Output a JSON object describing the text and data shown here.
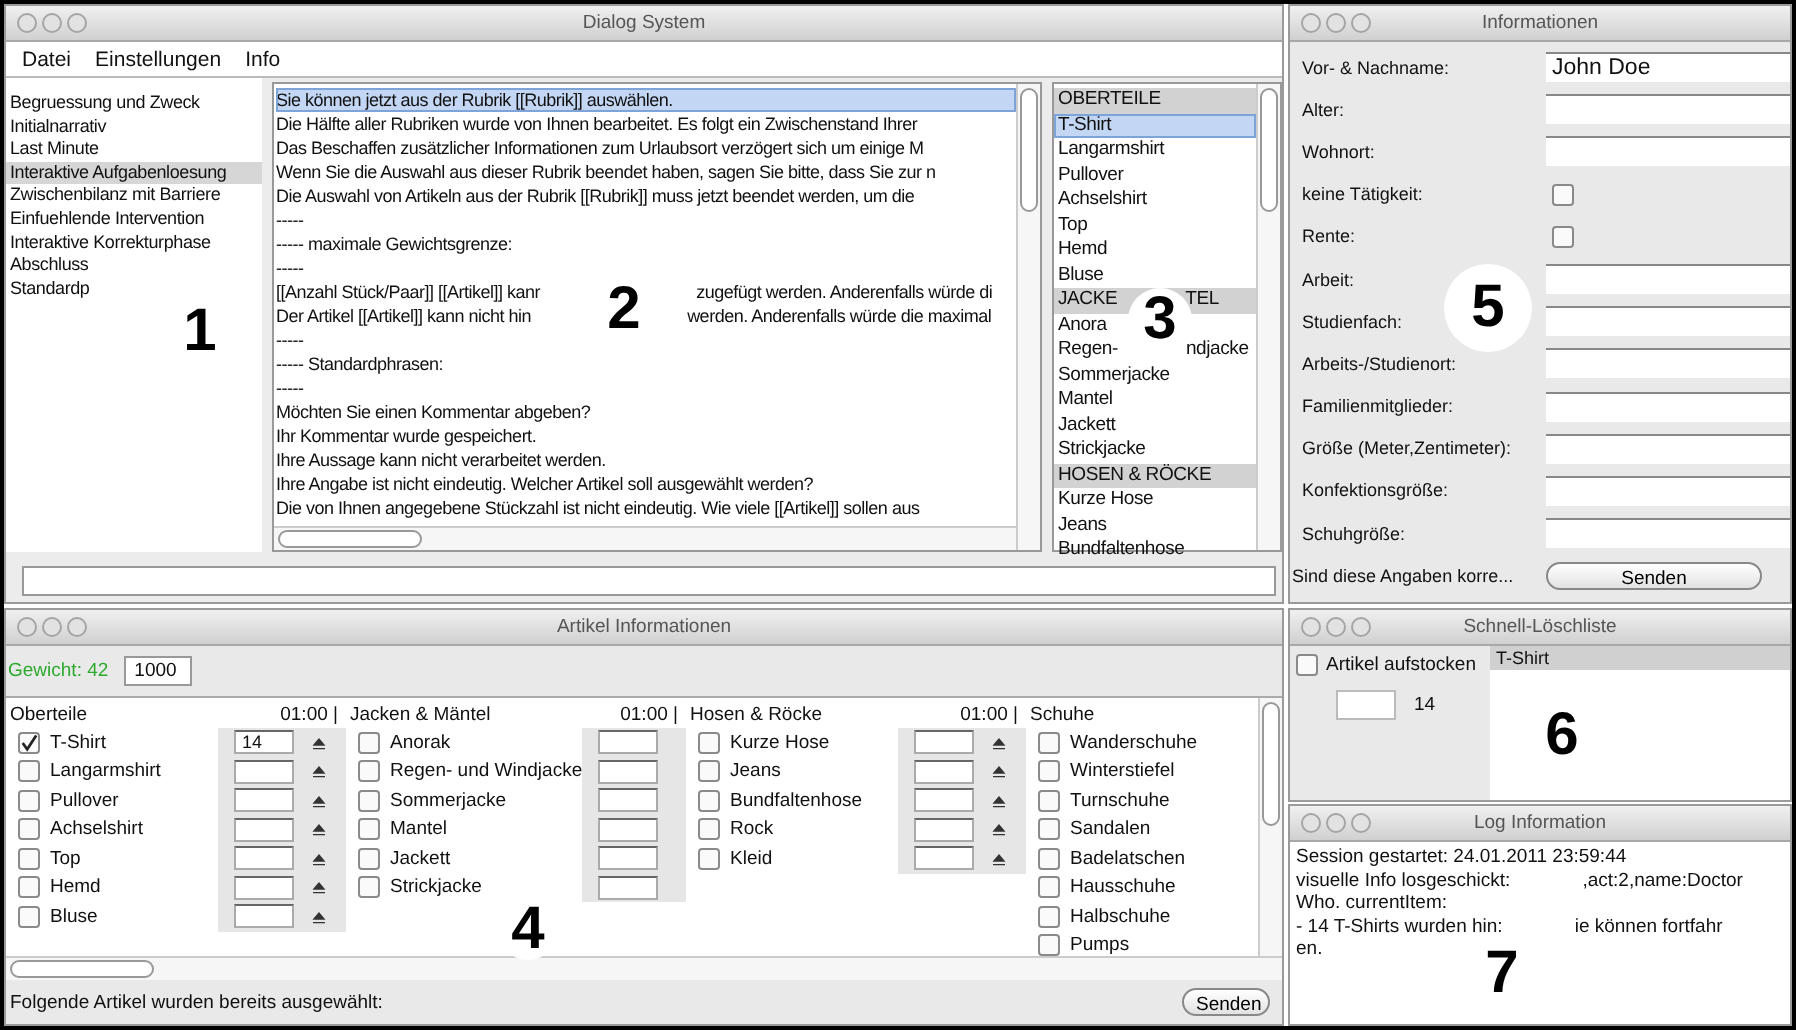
{
  "dialog": {
    "title": "Dialog System",
    "menu": [
      "Datei",
      "Einstellungen",
      "Info"
    ],
    "phases": [
      {
        "parts": [
          "Begruessung und Zweck"
        ],
        "selected": false
      },
      {
        "parts": [
          "Initialnarrativ"
        ],
        "selected": false
      },
      {
        "parts": [
          "Last Minute"
        ],
        "selected": false
      },
      {
        "parts": [
          "Interaktive Aufgabenloesung"
        ],
        "selected": true
      },
      {
        "parts": [
          "Zwischenbilanz mit Barriere"
        ],
        "selected": false
      },
      {
        "parts": [
          "Einfuehlende Intervention"
        ],
        "selected": false
      },
      {
        "parts": [
          "Interaktive Korrekturphase"
        ],
        "selected": false
      },
      {
        "parts": [
          "Abschluss"
        ],
        "selected": false
      },
      {
        "parts": [
          "Standardp"
        ],
        "selected": false
      }
    ],
    "phrases": [
      {
        "parts": [
          "Sie können jetzt aus der Rubrik [[Rubrik]] auswählen."
        ],
        "selected": true
      },
      {
        "parts": [
          "Die Hälfte aller Rubriken wurde von Ihnen bearbeitet. Es folgt ein Zwischenstand Ihrer"
        ],
        "selected": false
      },
      {
        "parts": [
          "Das Beschaffen zusätzlicher Informationen zum Urlaubsort verzögert sich um einige M"
        ],
        "selected": false
      },
      {
        "parts": [
          "Wenn Sie die Auswahl aus dieser Rubrik beendet haben, sagen Sie bitte, dass Sie zur n"
        ],
        "selected": false
      },
      {
        "parts": [
          "Die Auswahl von Artikeln aus der Rubrik [[Rubrik]] muss jetzt beendet werden, um die"
        ],
        "selected": false
      },
      {
        "parts": [
          "-----"
        ],
        "selected": false
      },
      {
        "parts": [
          "----- maximale Gewichtsgrenze:"
        ],
        "selected": false
      },
      {
        "parts": [
          "-----"
        ],
        "selected": false
      },
      {
        "parts": [
          "[[Anzahl Stück/Paar]] [[Artikel]] kanr",
          "zugefügt werden. Anderenfalls würde di"
        ],
        "selected": false
      },
      {
        "parts": [
          "Der Artikel [[Artikel]] kann nicht hin",
          "werden. Anderenfalls würde die maximal"
        ],
        "selected": false
      },
      {
        "parts": [
          "-----"
        ],
        "selected": false
      },
      {
        "parts": [
          "----- Standardphrasen:"
        ],
        "selected": false
      },
      {
        "parts": [
          "-----"
        ],
        "selected": false
      },
      {
        "parts": [
          "Möchten Sie einen Kommentar abgeben?"
        ],
        "selected": false
      },
      {
        "parts": [
          "Ihr Kommentar wurde gespeichert."
        ],
        "selected": false
      },
      {
        "parts": [
          "Ihre Aussage kann nicht verarbeitet werden."
        ],
        "selected": false
      },
      {
        "parts": [
          "Ihre Angabe ist nicht eindeutig. Welcher Artikel soll ausgewählt werden?"
        ],
        "selected": false
      },
      {
        "parts": [
          "Die von Ihnen angegebene Stückzahl ist nicht eindeutig. Wie viele [[Artikel]] sollen aus"
        ],
        "selected": false
      }
    ],
    "articles": [
      {
        "kind": "header",
        "parts": [
          "OBERTEILE"
        ],
        "selected": false
      },
      {
        "kind": "item",
        "parts": [
          "T-Shirt"
        ],
        "selected": true
      },
      {
        "kind": "item",
        "parts": [
          "Langarmshirt"
        ],
        "selected": false
      },
      {
        "kind": "item",
        "parts": [
          "Pullover"
        ],
        "selected": false
      },
      {
        "kind": "item",
        "parts": [
          "Achselshirt"
        ],
        "selected": false
      },
      {
        "kind": "item",
        "parts": [
          "Top"
        ],
        "selected": false
      },
      {
        "kind": "item",
        "parts": [
          "Hemd"
        ],
        "selected": false
      },
      {
        "kind": "item",
        "parts": [
          "Bluse"
        ],
        "selected": false
      },
      {
        "kind": "header",
        "parts": [
          "JACKE",
          "TEL"
        ],
        "selected": false
      },
      {
        "kind": "item",
        "parts": [
          "Anora"
        ],
        "selected": false
      },
      {
        "kind": "item",
        "parts": [
          "Regen-",
          "ndjacke"
        ],
        "selected": false
      },
      {
        "kind": "item",
        "parts": [
          "Sommerjacke"
        ],
        "selected": false
      },
      {
        "kind": "item",
        "parts": [
          "Mantel"
        ],
        "selected": false
      },
      {
        "kind": "item",
        "parts": [
          "Jackett"
        ],
        "selected": false
      },
      {
        "kind": "item",
        "parts": [
          "Strickjacke"
        ],
        "selected": false
      },
      {
        "kind": "header",
        "parts": [
          "HOSEN & RÖCKE"
        ],
        "selected": false
      },
      {
        "kind": "item",
        "parts": [
          "Kurze Hose"
        ],
        "selected": false
      },
      {
        "kind": "item",
        "parts": [
          "Jeans"
        ],
        "selected": false
      },
      {
        "kind": "item",
        "parts": [
          "Bundfaltenhose"
        ],
        "selected": false
      }
    ]
  },
  "info": {
    "title": "Informationen",
    "fields": [
      {
        "kind": "text",
        "label": "Vor- & Nachname:",
        "value": "John Doe"
      },
      {
        "kind": "text",
        "label": "Alter:"
      },
      {
        "kind": "text",
        "label": "Wohnort:"
      },
      {
        "kind": "checkbox",
        "label": "keine Tätigkeit:",
        "checked": false
      },
      {
        "kind": "checkbox",
        "label": "Rente:",
        "checked": false
      },
      {
        "kind": "text",
        "label": "Arbeit:"
      },
      {
        "kind": "text",
        "label": "Studienfach:"
      },
      {
        "kind": "text",
        "label": "Arbeits-/Studienort:"
      },
      {
        "kind": "text",
        "label": "Familienmitglieder:"
      },
      {
        "kind": "text",
        "label": "Größe (Meter,Zentimeter):"
      },
      {
        "kind": "text",
        "label": "Konfektionsgröße:"
      },
      {
        "kind": "text",
        "label": "Schuhgröße:"
      }
    ],
    "question": "Sind diese Angaben korre...",
    "button": "Senden"
  },
  "articles": {
    "title": "Artikel Informationen",
    "weight_label": "Gewicht: 42",
    "weight_value": "1000",
    "groups": [
      {
        "name": "Oberteile",
        "time": "01:00 |",
        "quantity_fields": true,
        "spinners": true,
        "items": [
          {
            "label": "T-Shirt",
            "checked": true,
            "quantity": "14"
          },
          {
            "label": "Langarmshirt",
            "checked": false
          },
          {
            "label": "Pullover",
            "checked": false
          },
          {
            "label": "Achselshirt",
            "checked": false
          },
          {
            "label": "Top",
            "checked": false
          },
          {
            "label": "Hemd",
            "checked": false
          },
          {
            "label": "Bluse",
            "checked": false
          }
        ]
      },
      {
        "name": "Jacken & Mäntel",
        "time": "01:00 |",
        "quantity_fields": true,
        "spinners": false,
        "items": [
          {
            "label": "Anorak",
            "checked": false
          },
          {
            "label": "Regen- und Windjacke",
            "checked": false
          },
          {
            "label": "Sommerjacke",
            "checked": false
          },
          {
            "label": "Mantel",
            "checked": false
          },
          {
            "label": "Jackett",
            "checked": false
          },
          {
            "label": "Strickjacke",
            "checked": false
          }
        ]
      },
      {
        "name": "Hosen & Röcke",
        "time": "01:00 |",
        "quantity_fields": true,
        "spinners": true,
        "items": [
          {
            "label": "Kurze Hose",
            "checked": false
          },
          {
            "label": "Jeans",
            "checked": false
          },
          {
            "label": "Bundfaltenhose",
            "checked": false
          },
          {
            "label": "Rock",
            "checked": false
          },
          {
            "label": "Kleid",
            "checked": false
          }
        ]
      },
      {
        "name": "Schuhe",
        "quantity_fields": false,
        "items": [
          {
            "label": "Wanderschuhe",
            "checked": false
          },
          {
            "label": "Winterstiefel",
            "checked": false
          },
          {
            "label": "Turnschuhe",
            "checked": false
          },
          {
            "label": "Sandalen",
            "checked": false
          },
          {
            "label": "Badelatschen",
            "checked": false
          },
          {
            "label": "Hausschuhe",
            "checked": false
          },
          {
            "label": "Halbschuhe",
            "checked": false
          },
          {
            "label": "Pumps",
            "checked": false
          }
        ]
      }
    ],
    "footer": "Folgende Artikel wurden bereits ausgewählt:",
    "button": "Senden"
  },
  "quick": {
    "title": "Schnell-Löschliste",
    "option": {
      "label": "Artikel aufstocken",
      "checked": false
    },
    "count": "14",
    "items": [
      {
        "label": "T-Shirt",
        "selected": true
      }
    ]
  },
  "log": {
    "title": "Log Information",
    "lines": [
      {
        "parts": [
          "Session gestartet: 24.01.2011 23:59:44"
        ]
      },
      {
        "parts": [
          "visuelle Info losgeschickt:",
          ",act:2,name:Doctor"
        ]
      },
      {
        "parts": [
          "Who. currentItem:"
        ]
      },
      {
        "parts": [
          "- 14 T-Shirts wurden hin:",
          "ie können fortfahr"
        ]
      },
      {
        "parts": [
          "en."
        ]
      }
    ]
  },
  "callouts": [
    {
      "label": "1"
    },
    {
      "label": "2"
    },
    {
      "label": "3"
    },
    {
      "label": "4"
    },
    {
      "label": "5"
    },
    {
      "label": "6"
    },
    {
      "label": "7"
    }
  ]
}
